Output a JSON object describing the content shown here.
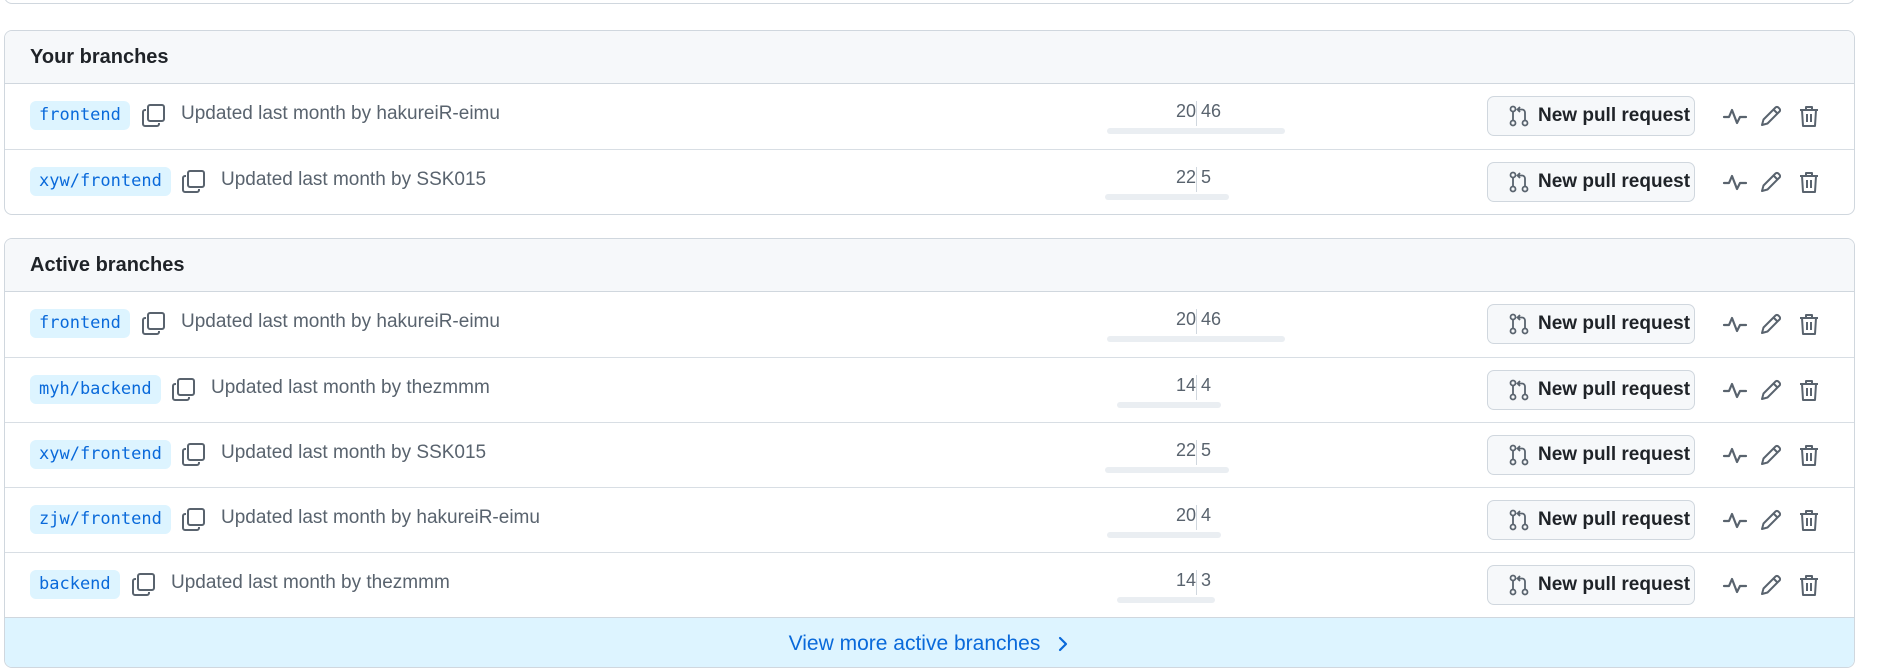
{
  "your_branches": {
    "title": "Your branches",
    "rows": [
      {
        "branch": "frontend",
        "updated": "Updated last month by hakureiR-eimu",
        "behind": "20",
        "ahead": "46",
        "pr_label": "New pull request"
      },
      {
        "branch": "xyw/frontend",
        "updated": "Updated last month by SSK015",
        "behind": "22",
        "ahead": "5",
        "pr_label": "New pull request"
      }
    ]
  },
  "active_branches": {
    "title": "Active branches",
    "rows": [
      {
        "branch": "frontend",
        "updated": "Updated last month by hakureiR-eimu",
        "behind": "20",
        "ahead": "46",
        "pr_label": "New pull request"
      },
      {
        "branch": "myh/backend",
        "updated": "Updated last month by thezmmm",
        "behind": "14",
        "ahead": "4",
        "pr_label": "New pull request"
      },
      {
        "branch": "xyw/frontend",
        "updated": "Updated last month by SSK015",
        "behind": "22",
        "ahead": "5",
        "pr_label": "New pull request"
      },
      {
        "branch": "zjw/frontend",
        "updated": "Updated last month by hakureiR-eimu",
        "behind": "20",
        "ahead": "4",
        "pr_label": "New pull request"
      },
      {
        "branch": "backend",
        "updated": "Updated last month by thezmmm",
        "behind": "14",
        "ahead": "3",
        "pr_label": "New pull request"
      }
    ],
    "view_more": "View more active branches"
  },
  "icons": {
    "copy": "copy-icon",
    "pull_request": "git-pull-request-icon",
    "activity": "pulse-icon",
    "rename": "pencil-icon",
    "delete": "trash-icon",
    "chevron": "chevron-right-icon"
  },
  "colors": {
    "link": "#0969da",
    "branch_bg": "#ddf4ff",
    "header_bg": "#f6f8fa",
    "border": "#d0d7de"
  }
}
